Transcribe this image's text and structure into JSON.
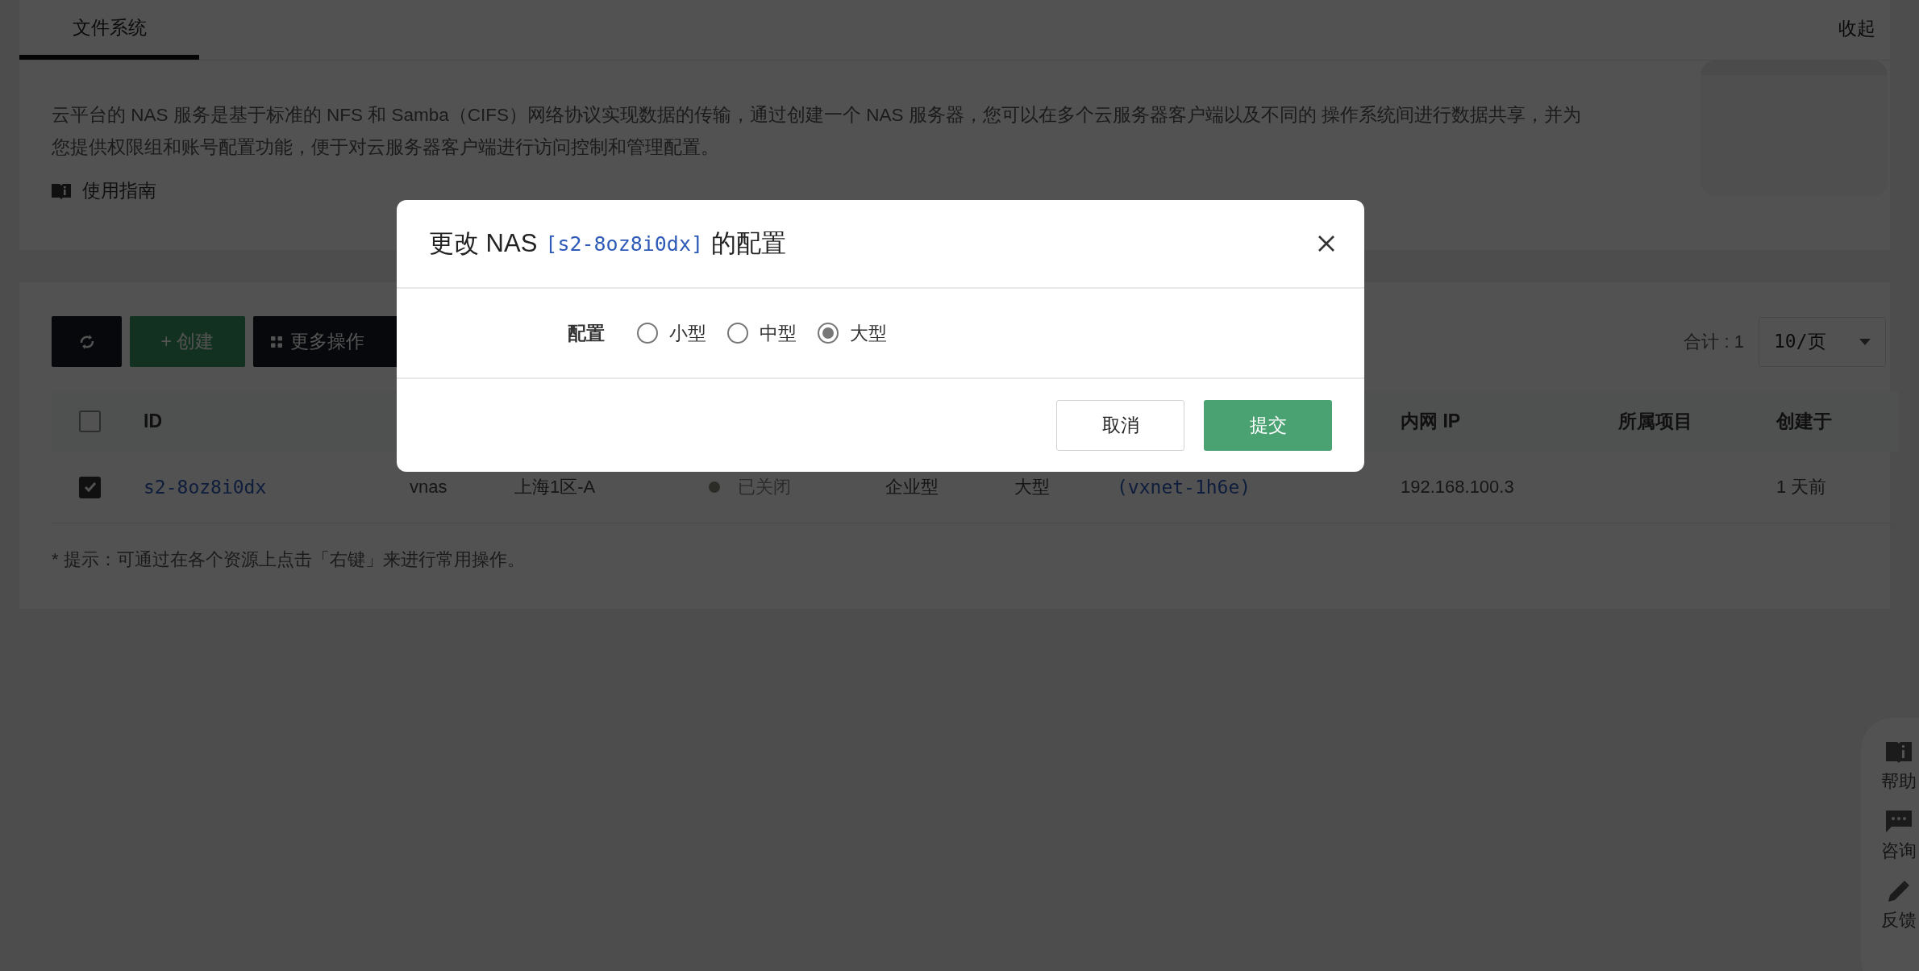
{
  "tabs": [
    {
      "label": "文件系统",
      "selected": true
    }
  ],
  "collapse_link": "收起",
  "intro": {
    "text": "云平台的 NAS 服务是基于标准的 NFS 和 Samba（CIFS）网络协议实现数据的传输，通过创建一个 NAS 服务器，您可以在多个云服务器客户端以及不同的 操作系统间进行数据共享，并为您提供权限组和账号配置功能，便于对云服务器客户端进行访问控制和管理配置。",
    "guide_link": "使用指南"
  },
  "toolbar": {
    "create": "+ 创建",
    "more": "更多操作",
    "total": "合计 : 1",
    "page_size": "10/页"
  },
  "table": {
    "header_checked": false,
    "columns": {
      "id": "ID",
      "intranet_ip": "内网 IP",
      "project": "所属项目",
      "created": "创建于"
    },
    "rows": [
      {
        "selected": true,
        "id": "s2-8oz8i0dx",
        "name": "vnas",
        "zone": "上海1区-A",
        "status": "已关闭",
        "type": "企业型",
        "config": "大型",
        "network": "(vxnet-1h6e)",
        "intranet_ip": "192.168.100.3",
        "created": "1 天前"
      }
    ]
  },
  "hint": "* 提示：可通过在各个资源上点击「右键」来进行常用操作。",
  "side_panel": [
    {
      "kind": "help",
      "label": "帮助"
    },
    {
      "kind": "chat",
      "label": "咨询"
    },
    {
      "kind": "feedback",
      "label": "反馈"
    }
  ],
  "dialog": {
    "title_prefix": "更改 NAS",
    "resource": "[s2-8oz8i0dx]",
    "title_suffix": "的配置",
    "field_label": "配置",
    "options": [
      {
        "label": "小型",
        "selected": false
      },
      {
        "label": "中型",
        "selected": false
      },
      {
        "label": "大型",
        "selected": true
      }
    ],
    "cancel": "取消",
    "submit": "提交"
  }
}
